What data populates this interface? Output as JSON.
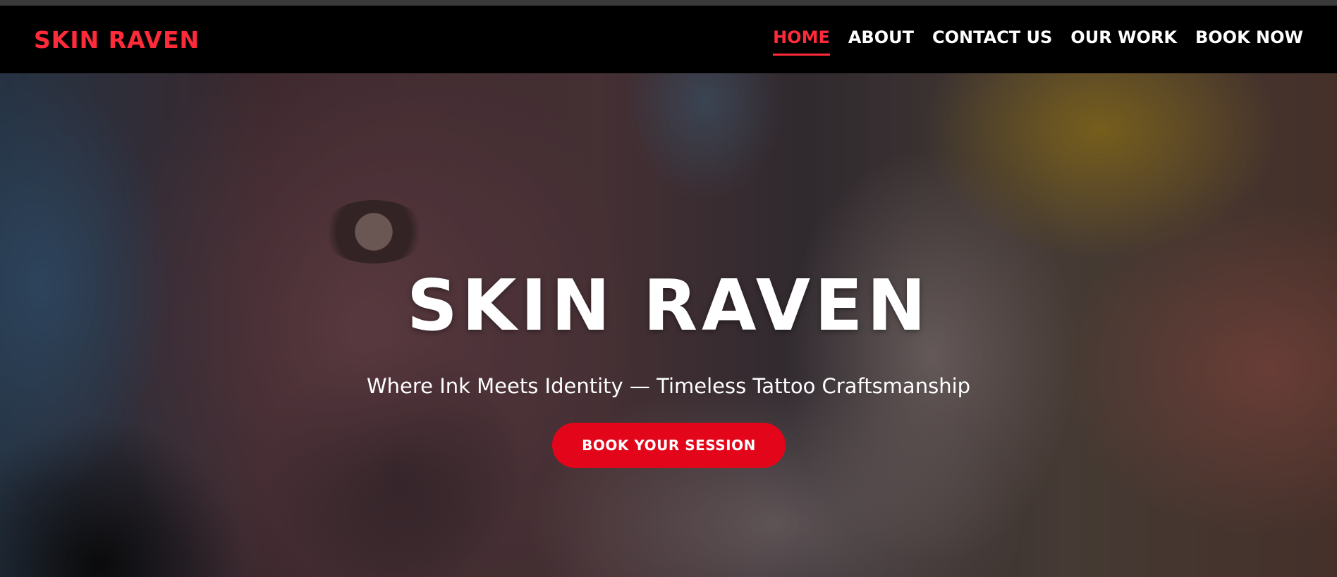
{
  "brand": {
    "name": "SKIN RAVEN",
    "accent_color": "#ff2b3a",
    "button_color": "#e3061a"
  },
  "nav": {
    "items": [
      {
        "label": "HOME",
        "active": true
      },
      {
        "label": "ABOUT",
        "active": false
      },
      {
        "label": "CONTACT US",
        "active": false
      },
      {
        "label": "OUR WORK",
        "active": false
      },
      {
        "label": "BOOK NOW",
        "active": false
      }
    ]
  },
  "hero": {
    "title": "SKIN RAVEN",
    "subtitle": "Where Ink Meets Identity — Timeless Tattoo Craftsmanship",
    "cta_label": "BOOK YOUR SESSION"
  }
}
